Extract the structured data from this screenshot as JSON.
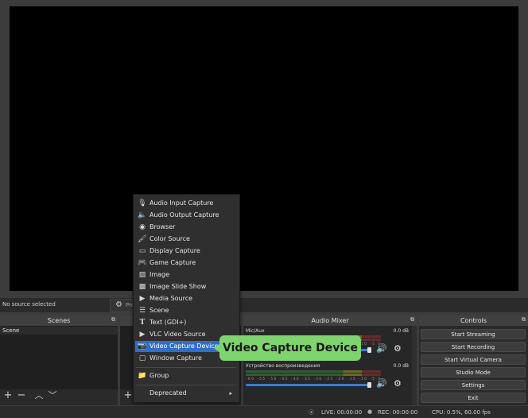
{
  "source_bar": {
    "no_source": "No source selected",
    "properties_label": "Pro"
  },
  "docks": {
    "scenes": {
      "title": "Scenes",
      "items": [
        "Scene"
      ]
    },
    "audio_mixer": {
      "title": "Audio Mixer",
      "channels": [
        {
          "name": "Mic/Aux",
          "db": "0.0 dB"
        },
        {
          "name": "Устройство воспроизведения",
          "db": "0.0 dB"
        }
      ],
      "meter_ticks": "-60 -55 -50 -45 -40 -35 -30 -25 -20 -15 -10 -5 0"
    },
    "controls": {
      "title": "Controls",
      "buttons": [
        "Start Streaming",
        "Start Recording",
        "Start Virtual Camera",
        "Studio Mode",
        "Settings",
        "Exit"
      ]
    }
  },
  "status_bar": {
    "live": "LIVE: 00:00:00",
    "rec": "REC: 00:00:00",
    "cpu": "CPU: 0.5%, 60.00 fps"
  },
  "context_menu": {
    "items": [
      {
        "label": "Audio Input Capture",
        "icon": "microphone-icon"
      },
      {
        "label": "Audio Output Capture",
        "icon": "speaker-icon"
      },
      {
        "label": "Browser",
        "icon": "globe-icon"
      },
      {
        "label": "Color Source",
        "icon": "brush-icon"
      },
      {
        "label": "Display Capture",
        "icon": "monitor-icon"
      },
      {
        "label": "Game Capture",
        "icon": "gamepad-icon"
      },
      {
        "label": "Image",
        "icon": "image-icon"
      },
      {
        "label": "Image Slide Show",
        "icon": "slideshow-icon"
      },
      {
        "label": "Media Source",
        "icon": "play-icon"
      },
      {
        "label": "Scene",
        "icon": "list-icon"
      },
      {
        "label": "Text (GDI+)",
        "icon": "text-icon"
      },
      {
        "label": "VLC Video Source",
        "icon": "play-icon"
      },
      {
        "label": "Video Capture Device",
        "icon": "camera-icon",
        "selected": true
      },
      {
        "label": "Window Capture",
        "icon": "window-icon"
      },
      {
        "label": "Group",
        "icon": "folder-icon"
      },
      {
        "label": "Deprecated",
        "icon": "",
        "submenu": true
      }
    ]
  },
  "callout": {
    "text": "Video Capture Device",
    "color": "#7fd46f"
  },
  "colors": {
    "accent": "#2f6fc8",
    "preview_bg": "#000000"
  }
}
